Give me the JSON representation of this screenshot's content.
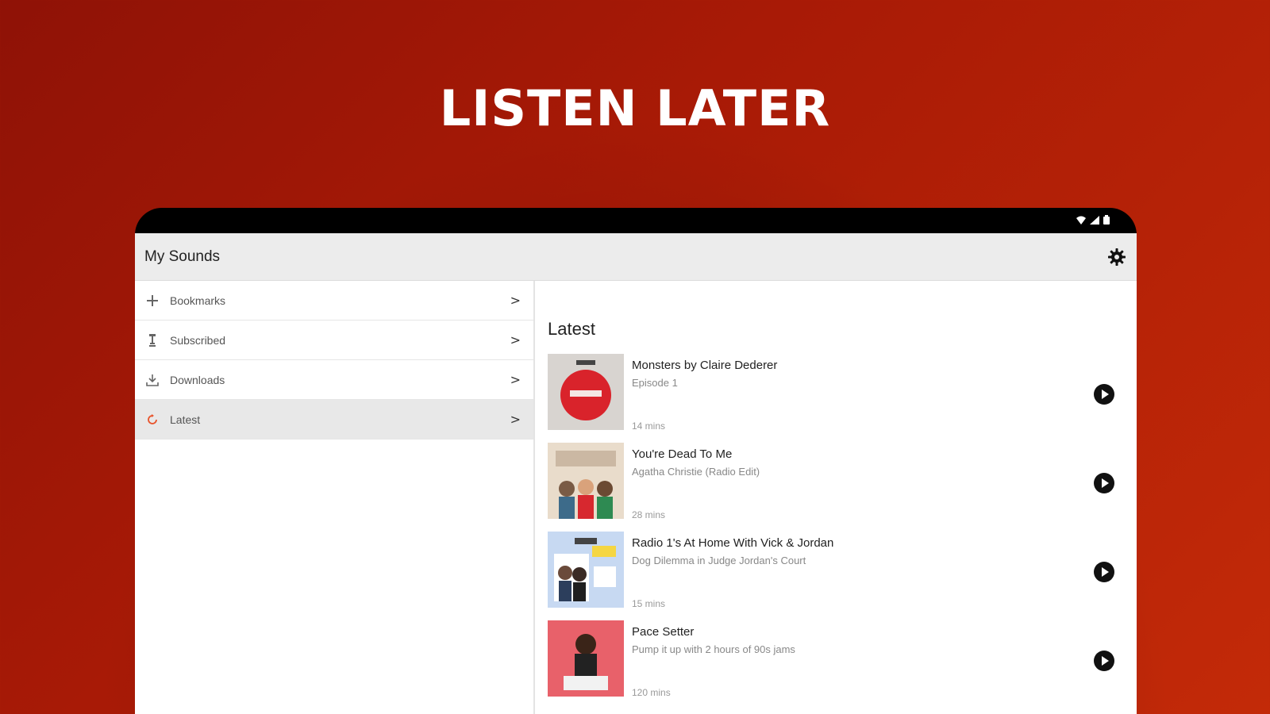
{
  "banner": {
    "headline": "LISTEN LATER"
  },
  "status_bar": {
    "icons": [
      "wifi-icon",
      "signal-icon",
      "battery-icon"
    ]
  },
  "appbar": {
    "title": "My Sounds",
    "settings_icon": "gear-icon"
  },
  "sidebar": {
    "items": [
      {
        "label": "Bookmarks",
        "icon": "bookmark-plus-icon",
        "active": false
      },
      {
        "label": "Subscribed",
        "icon": "subscribed-icon",
        "active": false
      },
      {
        "label": "Downloads",
        "icon": "download-icon",
        "active": false
      },
      {
        "label": "Latest",
        "icon": "latest-icon",
        "active": true
      }
    ]
  },
  "main": {
    "section_title": "Latest",
    "episodes": [
      {
        "title": "Monsters by Claire Dederer",
        "subtitle": "Episode 1",
        "duration": "14 mins",
        "art_color": "#d9232b"
      },
      {
        "title": "You're Dead To Me",
        "subtitle": "Agatha Christie (Radio Edit)",
        "duration": "28 mins",
        "art_color": "#e9dccb"
      },
      {
        "title": "Radio 1's At Home With Vick & Jordan",
        "subtitle": "Dog Dilemma in Judge Jordan's Court",
        "duration": "15 mins",
        "art_color": "#c7d9f2"
      },
      {
        "title": "Pace Setter",
        "subtitle": "Pump it up with 2 hours of 90s jams",
        "duration": "120 mins",
        "art_color": "#e34a55"
      }
    ]
  },
  "colors": {
    "brand_red": "#a81a06",
    "play_button": "#111111"
  }
}
